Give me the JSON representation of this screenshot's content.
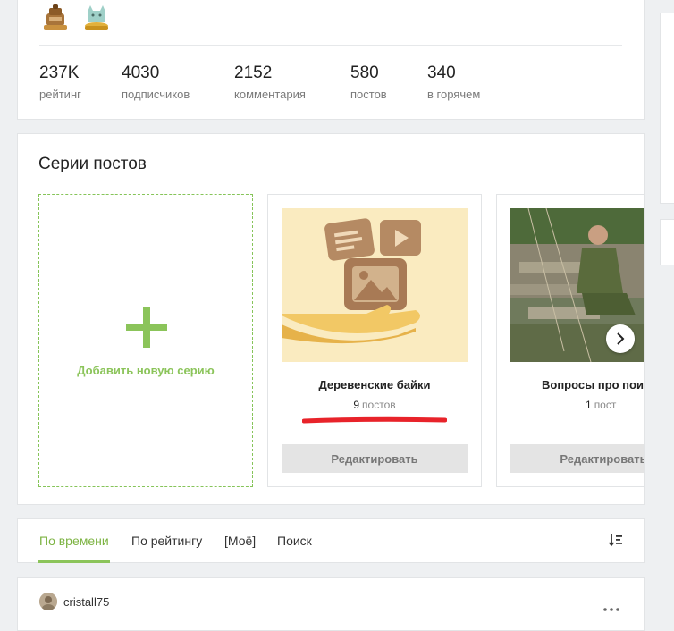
{
  "stats": [
    {
      "value": "237K",
      "label": "рейтинг"
    },
    {
      "value": "4030",
      "label": "подписчиков"
    },
    {
      "value": "2152",
      "label": "комментария"
    },
    {
      "value": "580",
      "label": "постов"
    },
    {
      "value": "340",
      "label": "в горячем"
    }
  ],
  "awards": [
    {
      "icon": "bronze-weight-award-icon"
    },
    {
      "icon": "gold-cat-award-icon"
    }
  ],
  "series": {
    "title": "Серии постов",
    "add_label": "Добавить новую серию",
    "items": [
      {
        "title": "Деревенские байки",
        "count": "9",
        "count_label": "постов",
        "edit_label": "Редактировать"
      },
      {
        "title": "Вопросы про пои",
        "count": "1",
        "count_label": "пост",
        "edit_label": "Редактировать"
      }
    ]
  },
  "tabs": {
    "items": [
      "По времени",
      "По рейтингу",
      "[Моё]",
      "Поиск"
    ],
    "active": "По времени"
  },
  "post": {
    "author": "cristall75"
  },
  "colors": {
    "accent": "#8bc45a",
    "highlight": "#e8232a",
    "background": "#eef0f2"
  }
}
